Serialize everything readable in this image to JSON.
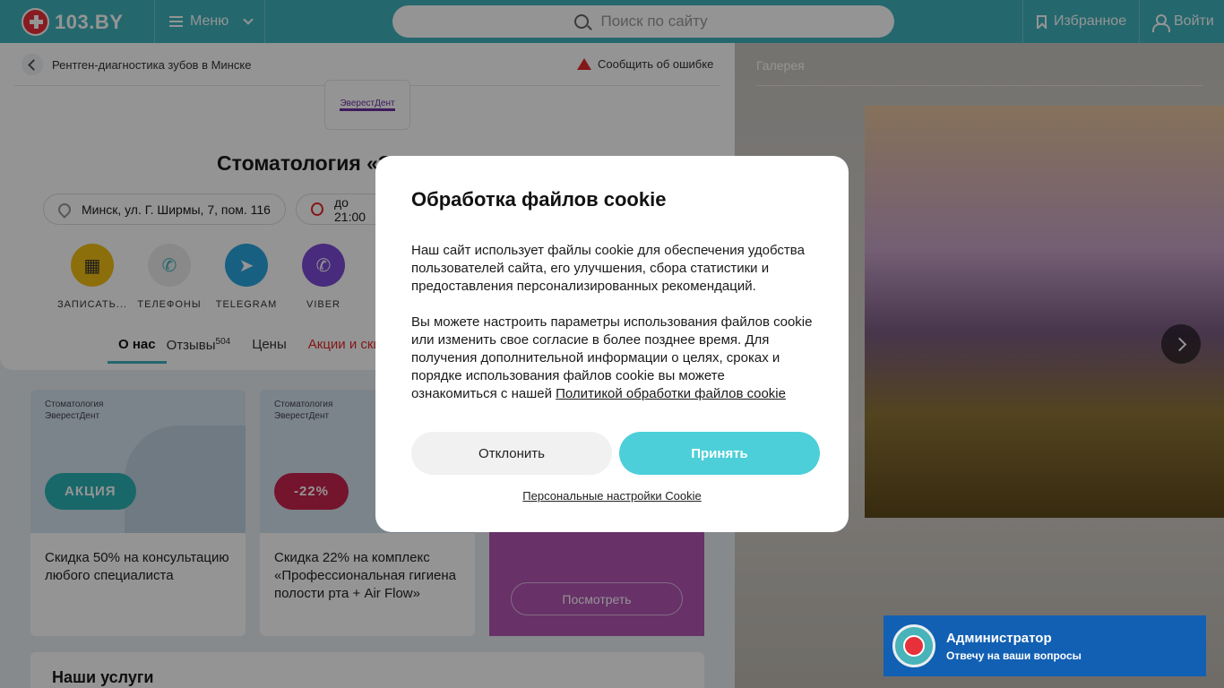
{
  "header": {
    "logo_text": "103.BY",
    "menu_label": "Меню",
    "search_placeholder": "Поиск по сайту",
    "favorites_label": "Избранное",
    "login_label": "Войти"
  },
  "breadcrumb": {
    "label": "Рентген-диагностика зубов в Минске"
  },
  "report_error": "Сообщить об ошибке",
  "clinic": {
    "logo_text": "ЭверестДент",
    "title": "Стоматология «ЭверестДент»",
    "address": "Минск, ул. Г. Ширмы, 7, пом. 116",
    "hours": "до 21:00"
  },
  "actions": [
    {
      "label": "ЗАПИСАТЬ...",
      "icon": "calendar-icon",
      "color": "#f2c014"
    },
    {
      "label": "ТЕЛЕФОНЫ",
      "icon": "phone-icon",
      "color": "#ececec"
    },
    {
      "label": "TELEGRAM",
      "icon": "telegram-icon",
      "color": "#2aa5df"
    },
    {
      "label": "VIBER",
      "icon": "viber-icon",
      "color": "#7d4bd6"
    }
  ],
  "tabs": [
    {
      "label": "О нас"
    },
    {
      "label": "Отзывы",
      "count": "504"
    },
    {
      "label": "Цены"
    },
    {
      "label": "Акции и скидки"
    }
  ],
  "promos": [
    {
      "brand": "Стоматология\nЭверестДент",
      "badge": "АКЦИЯ",
      "badge_color": "#2cb3b6",
      "text": "Скидка 50% на консультацию любого специалиста"
    },
    {
      "brand": "Стоматология\nЭверестДент",
      "badge": "-22%",
      "badge_color": "#c8234f",
      "text": "Скидка 22% на комплекс «Профессиональная гигиена полости рта + Air Flow»"
    }
  ],
  "view_button": "Посмотреть",
  "services_title": "Наши услуги",
  "gallery": {
    "title": "Галерея"
  },
  "cookie": {
    "title": "Обработка файлов cookie",
    "paragraph1": "Наш сайт использует файлы cookie для обеспечения удобства пользователей сайта, его улучшения, сбора статистики и предоставления персонализированных рекомендаций.",
    "paragraph2": "Вы можете настроить параметры использования файлов cookie или изменить свое согласие в более позднее время. Для получения дополнительной информации о целях, сроках и порядке использования файлов cookie вы можете ознакомиться с нашей ",
    "policy_link": "Политикой обработки файлов cookie",
    "decline": "Отклонить",
    "accept": "Принять",
    "personal_settings": "Персональные настройки Cookie"
  },
  "admin": {
    "name": "Администратор",
    "subtitle": "Отвечу на ваши вопросы"
  }
}
